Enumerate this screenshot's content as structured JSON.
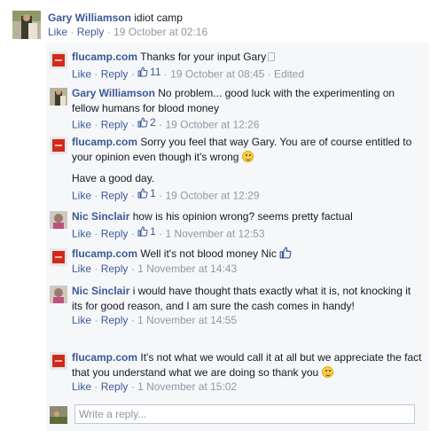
{
  "top_comment": {
    "author": "Gary Williamson",
    "text": "idiot camp",
    "like": "Like",
    "reply": "Reply",
    "sep": "·",
    "time": "19 October at 02:16"
  },
  "replies": [
    {
      "author": "flucamp.com",
      "text": "Thanks for your input Gary",
      "like": "Like",
      "reply": "Reply",
      "sep": "·",
      "likes": "11",
      "time": "19 October at 08:45",
      "edited": "Edited"
    },
    {
      "author": "Gary Williamson",
      "text": "No problem... good luck with the experimenting on fellow humans for blood money",
      "like": "Like",
      "reply": "Reply",
      "sep": "·",
      "likes": "2",
      "time": "19 October at 12:26"
    },
    {
      "author": "flucamp.com",
      "text": "Sorry you feel that way Gary. You are of course entitled to your opinion even though it's wrong",
      "text2": "Have a good day.",
      "like": "Like",
      "reply": "Reply",
      "sep": "·",
      "likes": "1",
      "time": "19 October at 12:29"
    },
    {
      "author": "Nic Sinclair",
      "text": "how is his opinion wrong? seems pretty factual",
      "like": "Like",
      "reply": "Reply",
      "sep": "·",
      "likes": "1",
      "time": "1 November at 12:53"
    },
    {
      "author": "flucamp.com",
      "text": "Well it's not blood money Nic",
      "like": "Like",
      "reply": "Reply",
      "sep": "·",
      "time": "1 November at 14:43"
    },
    {
      "author": "Nic Sinclair",
      "text": "i would have thought thats exactly what it is, not knocking it its for good reason, and I am sure the cash comes in handy!",
      "like": "Like",
      "reply": "Reply",
      "sep": "·",
      "time": "1 November at 14:55"
    },
    {
      "author": "flucamp.com",
      "text": "It's not what we would call it at all but we appreciate the fact that you understand what we are doing so thank you",
      "like": "Like",
      "reply": "Reply",
      "sep": "·",
      "time": "1 November at 15:02"
    }
  ],
  "write_reply": {
    "placeholder": "Write a reply..."
  },
  "colors": {
    "link": "#3b5998",
    "meta": "#9197a3",
    "reply_bg": "#f6f7f9"
  },
  "icons": {
    "like": "thumbs-up-icon",
    "emoji": "smiley-icon"
  }
}
